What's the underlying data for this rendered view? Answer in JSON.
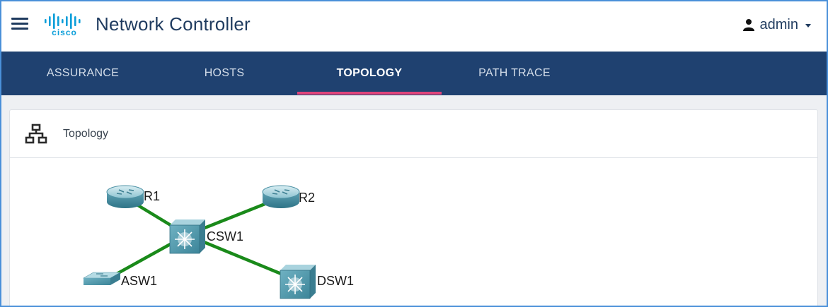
{
  "header": {
    "brand": "cisco",
    "title": "Network Controller",
    "user": "admin"
  },
  "nav": {
    "tabs": [
      {
        "label": "ASSURANCE",
        "active": false
      },
      {
        "label": "HOSTS",
        "active": false
      },
      {
        "label": "TOPOLOGY",
        "active": true
      },
      {
        "label": "PATH TRACE",
        "active": false
      }
    ]
  },
  "card": {
    "title": "Topology"
  },
  "topology": {
    "devices": [
      {
        "name": "R1",
        "type": "router"
      },
      {
        "name": "R2",
        "type": "router"
      },
      {
        "name": "CSW1",
        "type": "multilayer-switch"
      },
      {
        "name": "ASW1",
        "type": "switch"
      },
      {
        "name": "DSW1",
        "type": "multilayer-switch"
      }
    ],
    "links": [
      {
        "from": "R1",
        "to": "CSW1"
      },
      {
        "from": "R2",
        "to": "CSW1"
      },
      {
        "from": "ASW1",
        "to": "CSW1"
      },
      {
        "from": "DSW1",
        "to": "CSW1"
      }
    ],
    "link_color": "#1a8a1a"
  },
  "colors": {
    "nav_bg": "#1f4170",
    "accent": "#e0447a",
    "brand": "#1f3b5f"
  },
  "icons": {
    "menu": "hamburger-icon",
    "user": "user-icon",
    "topology": "topology-icon"
  }
}
